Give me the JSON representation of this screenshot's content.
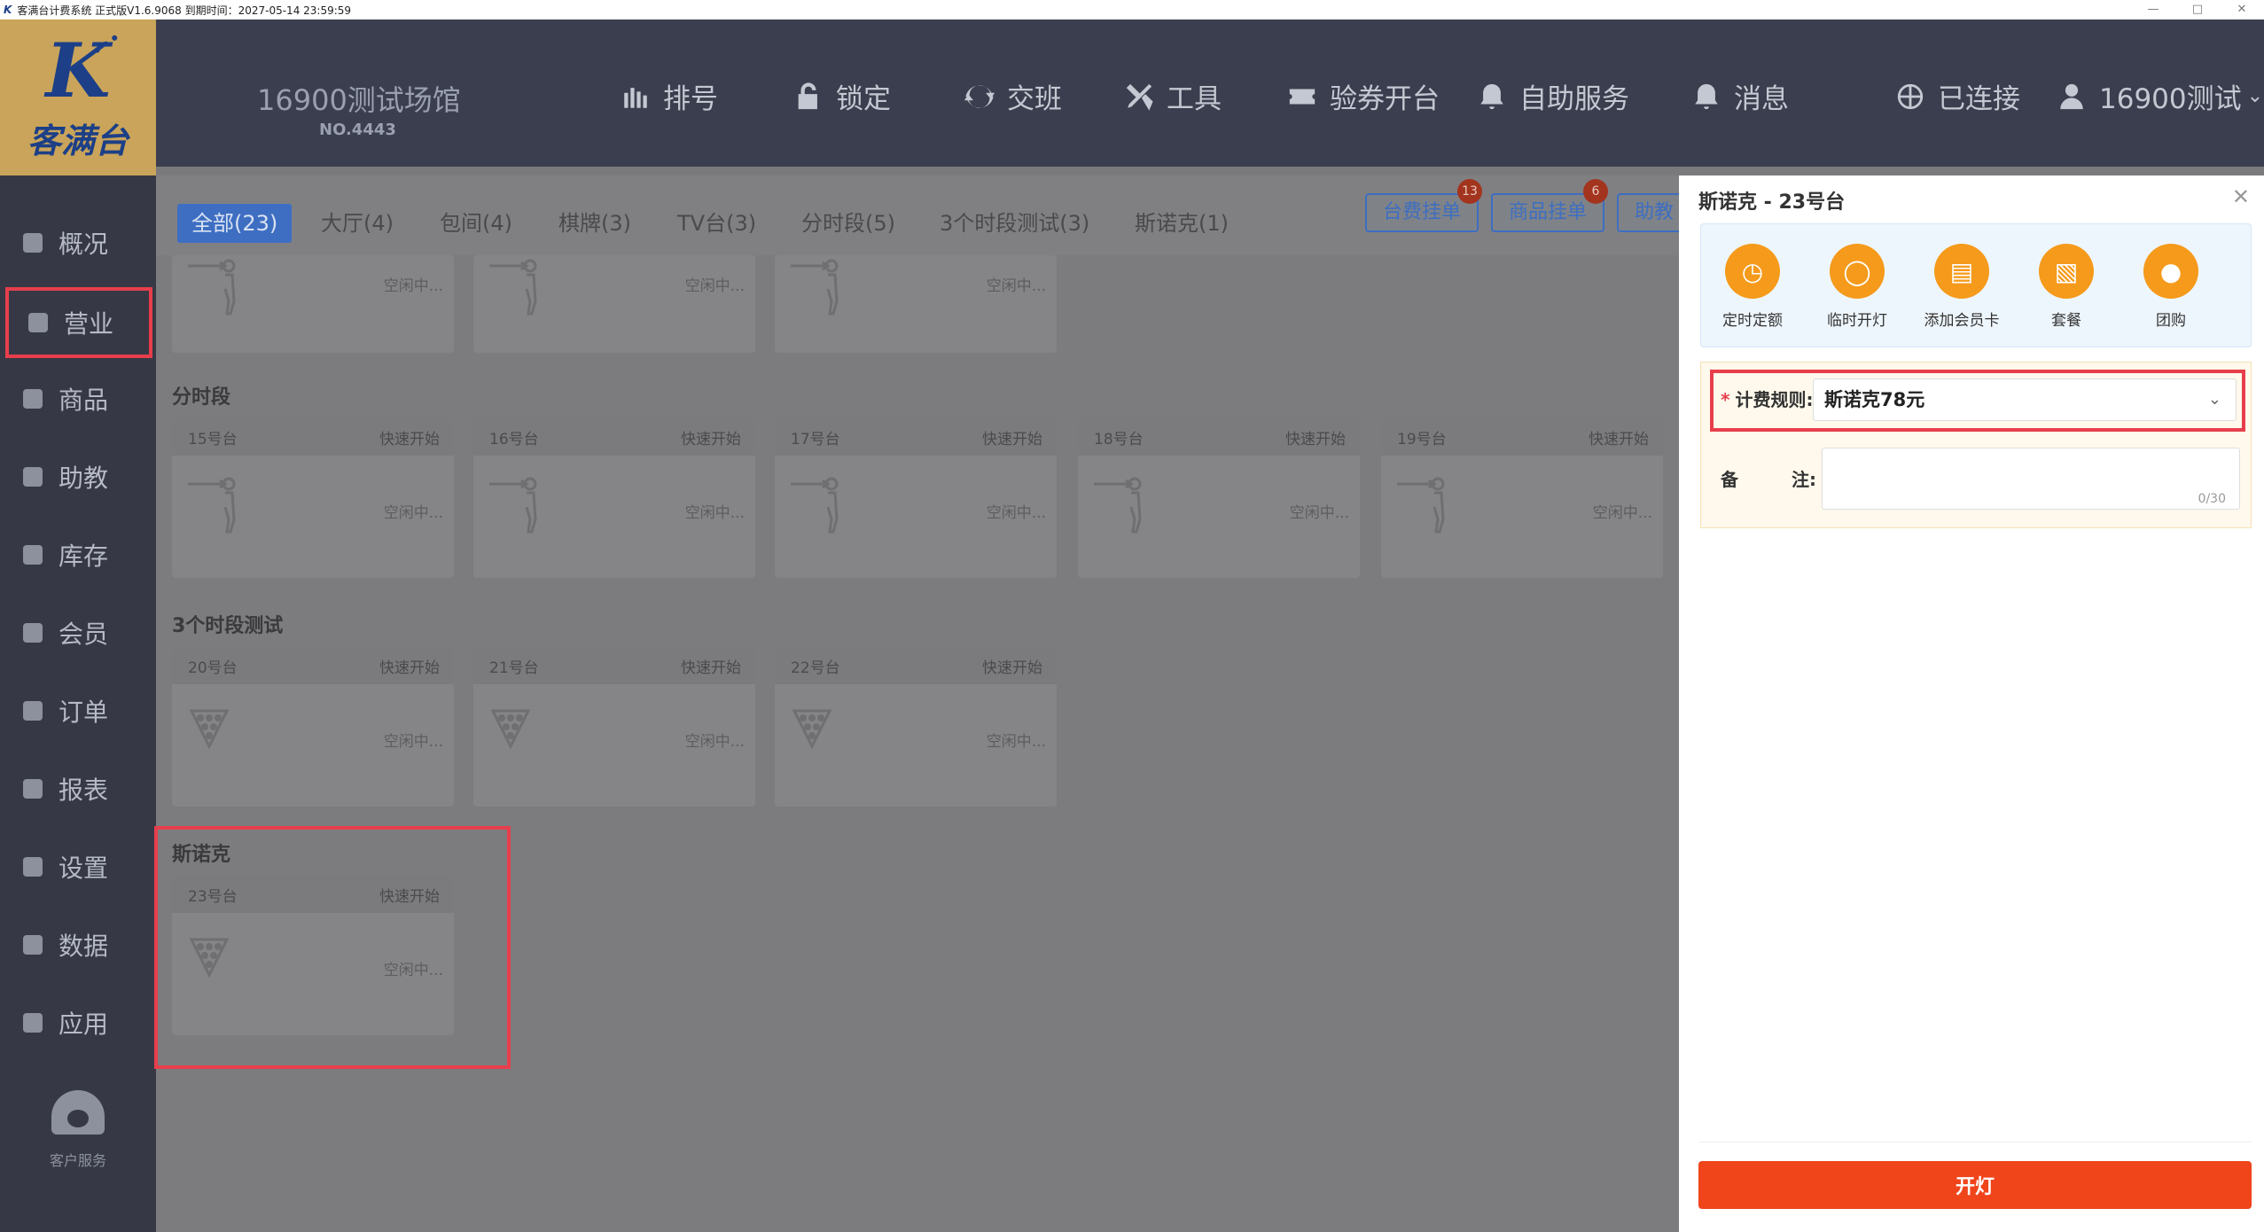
{
  "window": {
    "title": "客满台计费系统 正式版V1.6.9068 到期时间：2027-05-14 23:59:59",
    "logo_letter": "K",
    "controls": [
      "—",
      "□",
      "✕"
    ]
  },
  "brand": {
    "logo_text": "客满台"
  },
  "venue": {
    "name": "16900测试场馆",
    "number": "NO.4443"
  },
  "top_nav": [
    {
      "label": "排号",
      "icon": "queue-icon"
    },
    {
      "label": "锁定",
      "icon": "lock-icon"
    },
    {
      "label": "交班",
      "icon": "shift-icon"
    },
    {
      "label": "工具",
      "icon": "tools-icon"
    },
    {
      "label": "验券开台",
      "icon": "ticket-icon"
    },
    {
      "label": "自助服务",
      "icon": "bell-icon"
    },
    {
      "label": "消息",
      "icon": "bell-icon"
    },
    {
      "label": "已连接",
      "icon": "globe-icon"
    },
    {
      "label": "16900测试",
      "icon": "user-icon"
    }
  ],
  "sidebar": {
    "items": [
      {
        "label": "概况",
        "icon": "chart-icon"
      },
      {
        "label": "营业",
        "icon": "business-icon",
        "active": true
      },
      {
        "label": "商品",
        "icon": "goods-icon"
      },
      {
        "label": "助教",
        "icon": "assistant-icon"
      },
      {
        "label": "库存",
        "icon": "inventory-icon"
      },
      {
        "label": "会员",
        "icon": "member-icon"
      },
      {
        "label": "订单",
        "icon": "order-icon"
      },
      {
        "label": "报表",
        "icon": "report-icon"
      },
      {
        "label": "设置",
        "icon": "settings-icon"
      },
      {
        "label": "数据",
        "icon": "data-icon"
      },
      {
        "label": "应用",
        "icon": "app-icon"
      }
    ],
    "service_label": "客户服务"
  },
  "tabs": [
    "全部(23)",
    "大厅(4)",
    "包间(4)",
    "棋牌(3)",
    "TV台(3)",
    "分时段(5)",
    "3个时段测试(3)",
    "斯诺克(1)"
  ],
  "tab_buttons": [
    {
      "label": "台费挂单",
      "badge": "13"
    },
    {
      "label": "商品挂单",
      "badge": "6"
    },
    {
      "label": "助教"
    }
  ],
  "quick_start": "快速开始",
  "idle": "空闲中...",
  "groups": [
    {
      "title": "分时段",
      "tables": [
        "15号台",
        "16号台",
        "17号台",
        "18号台",
        "19号台"
      ]
    },
    {
      "title": "3个时段测试",
      "tables": [
        "20号台",
        "21号台",
        "22号台"
      ]
    },
    {
      "title": "斯诺克",
      "tables": [
        "23号台"
      ]
    }
  ],
  "panel": {
    "title": "斯诺克 - 23号台",
    "close": "✕",
    "actions": [
      {
        "label": "定时定额",
        "icon": "timer-icon"
      },
      {
        "label": "临时开灯",
        "icon": "bulb-icon"
      },
      {
        "label": "添加会员卡",
        "icon": "card-icon"
      },
      {
        "label": "套餐",
        "icon": "basket-icon"
      },
      {
        "label": "团购",
        "icon": "group-icon"
      }
    ],
    "rule_required": "*",
    "rule_label": "计费规则:",
    "rule_value": "斯诺克78元",
    "caret": "⌄",
    "note_label_a": "备",
    "note_label_b": "注:",
    "note_value": "",
    "note_count": "0/30",
    "open_button": "开灯"
  }
}
